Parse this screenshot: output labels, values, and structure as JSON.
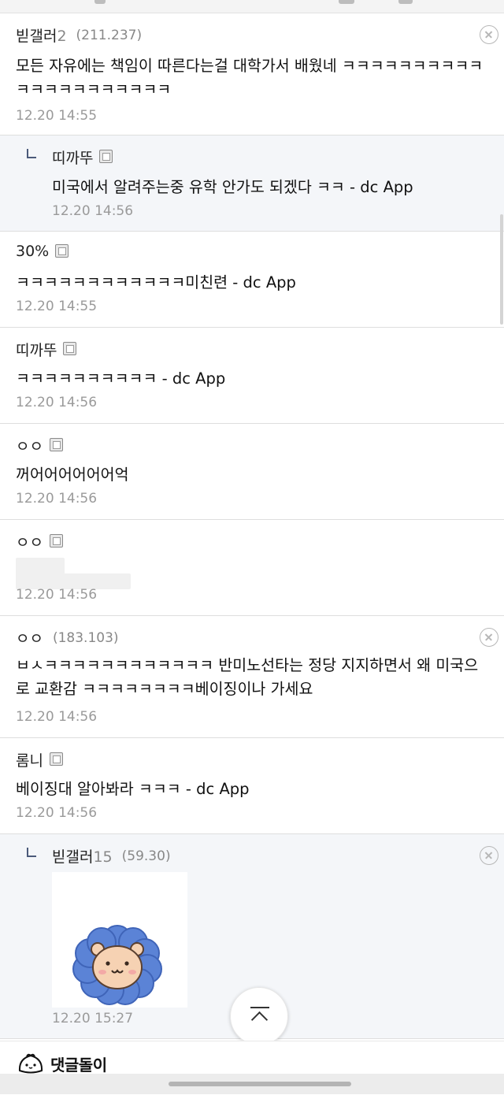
{
  "comments": [
    {
      "author": "빋갤러",
      "author_num": "2",
      "ip": "(211.237)",
      "text": "모든 자유에는 책임이 따른다는걸 대학가서 배웠네 ㅋㅋㅋㅋㅋㅋㅋㅋㅋㅋㅋㅋㅋㅋㅋㅋㅋㅋㅋㅋㅋ",
      "time": "12.20 14:55"
    },
    {
      "author": "띠까뚜",
      "text": "미국에서 알려주는중 유학 안가도 되겠다 ㅋㅋ - dc App",
      "time": "12.20 14:56"
    },
    {
      "author": "30%",
      "text": "ㅋㅋㅋㅋㅋㅋㅋㅋㅋㅋㅋㅋ미친련 - dc App",
      "time": "12.20 14:55"
    },
    {
      "author": "띠까뚜",
      "text": "ㅋㅋㅋㅋㅋㅋㅋㅋㅋㅋ - dc App",
      "time": "12.20 14:56"
    },
    {
      "author": "ㅇㅇ",
      "text": "꺼어어어어어어억",
      "time": "12.20 14:56"
    },
    {
      "author": "ㅇㅇ",
      "text": "",
      "time": "12.20 14:56"
    },
    {
      "author": "ㅇㅇ",
      "ip": "(183.103)",
      "text": "ㅂㅅㅋㅋㅋㅋㅋㅋㅋㅋㅋㅋㅋㅋ 반미노선타는 정당 지지하면서 왜 미국으로 교환감 ㅋㅋㅋㅋㅋㅋㅋㅋ베이징이나 가세요",
      "time": "12.20 14:56"
    },
    {
      "author": "롬니",
      "text": "베이징대 알아봐라 ㅋㅋㅋ - dc App",
      "time": "12.20 14:56"
    },
    {
      "author": "빋갤러",
      "author_num": "15",
      "ip": "(59.30)",
      "time": "12.20 15:27"
    }
  ],
  "footer": {
    "brand_label": "댓글돌이",
    "brand_icon": "dumpling-mascot-icon",
    "scroll_top_icon": "scroll-to-top-icon"
  }
}
